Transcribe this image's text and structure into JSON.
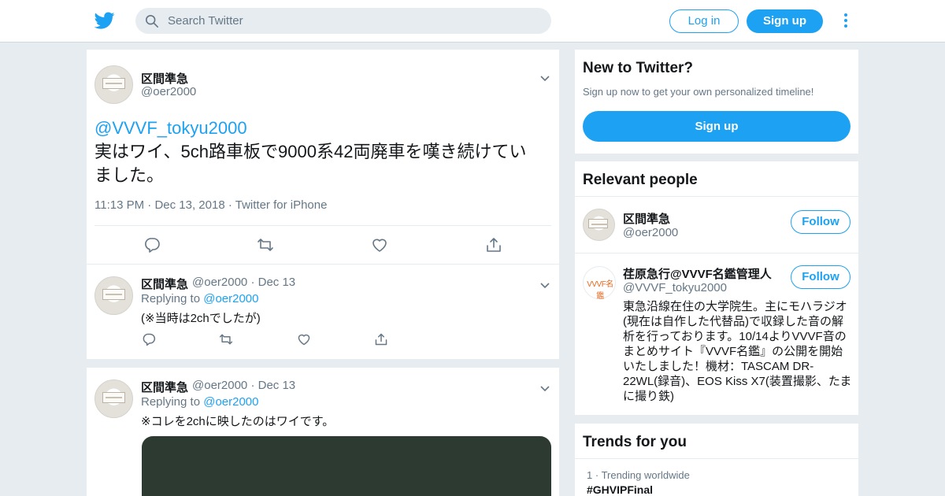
{
  "header": {
    "search_placeholder": "Search Twitter",
    "login_label": "Log in",
    "signup_label": "Sign up",
    "icons": {
      "logo": "twitter-bird-icon",
      "search": "search-icon",
      "more": "more-vertical-icon"
    }
  },
  "main_tweet": {
    "author_name": "区間準急",
    "author_handle": "@oer2000",
    "mention": "@VVVF_tokyu2000",
    "text": "実はワイ、5ch路車板で9000系42両廃車を嘆き続けていました。",
    "time": "11:13 PM",
    "date": "Dec 13, 2018",
    "source": "Twitter for iPhone"
  },
  "replies": [
    {
      "author_name": "区間準急",
      "author_handle": "@oer2000",
      "date": "Dec 13",
      "replying_to_label": "Replying to",
      "replying_to_handle": "@oer2000",
      "text": "(※当時は2chでしたが)"
    },
    {
      "author_name": "区間準急",
      "author_handle": "@oer2000",
      "date": "Dec 13",
      "replying_to_label": "Replying to",
      "replying_to_handle": "@oer2000",
      "text": "※コレを2chに映したのはワイです。"
    }
  ],
  "sidebar": {
    "new_to_twitter": {
      "title": "New to Twitter?",
      "subtitle": "Sign up now to get your own personalized timeline!",
      "button_label": "Sign up"
    },
    "relevant_people": {
      "title": "Relevant people",
      "people": [
        {
          "name": "区間準急",
          "handle": "@oer2000",
          "follow_label": "Follow"
        },
        {
          "name": "荏原急行@VVVF名鑑管理人",
          "handle": "@VVVF_tokyu2000",
          "follow_label": "Follow",
          "avatar_text": "VVVF名鑑",
          "bio": "東急沿線在住の大学院生。主にモハラジオ(現在は自作した代替品)で収録した音の解析を行っております。10/14よりVVVF音のまとめサイト『VVVF名鑑』の公開を開始いたしました！機材：TASCAM DR-22WL(録音)、EOS Kiss X7(装置撮影、たまに撮り鉄)"
        }
      ]
    },
    "trends": {
      "title": "Trends for you",
      "items": [
        {
          "rank": "1",
          "context": "Trending worldwide",
          "tag": "#GHVIPFinal"
        }
      ]
    }
  },
  "colors": {
    "accent": "#1da1f2",
    "background": "#e6ecf0",
    "muted": "#657786",
    "text": "#14171a"
  }
}
